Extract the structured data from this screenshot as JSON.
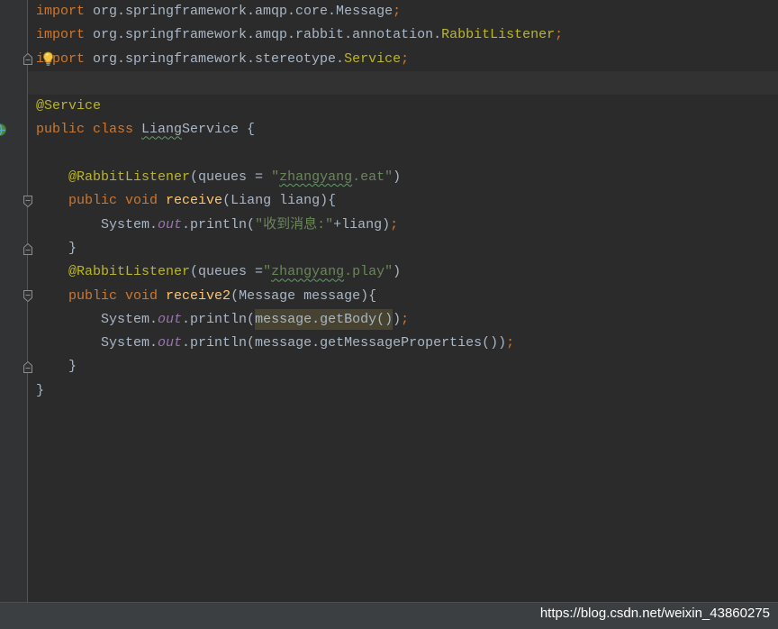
{
  "theme": {
    "background": "#2b2b2b",
    "gutter": "#313335",
    "gutter_border": "#555555",
    "current_line": "#323232",
    "keyword": "#cc7832",
    "text": "#a9b7c6",
    "annotation": "#bbb529",
    "string": "#6a8759",
    "method": "#ffc66d",
    "field": "#9876aa",
    "usage_highlight": "#474330",
    "typo_underline": "#659c6b",
    "fold_marker": "#8c8c8c",
    "bottom_bar": "#3c3f41",
    "watermark": "#ffffff"
  },
  "editor": {
    "lines": [
      {
        "tokens": [
          {
            "keyword": "import"
          },
          {
            "text": " org.springframework.amqp.core.Message"
          },
          {
            "keyword": ";"
          }
        ]
      },
      {
        "tokens": [
          {
            "keyword": "import"
          },
          {
            "text": " org.springframework.amqp.rabbit.annotation."
          },
          {
            "annotation": "RabbitListener"
          },
          {
            "keyword": ";"
          }
        ]
      },
      {
        "gutter_icon": "fold-end-icon",
        "inline_icon": "lightbulb-icon",
        "tokens": [
          {
            "keyword": "import"
          },
          {
            "text": " org.springframework.stereotype."
          },
          {
            "annotation": "Service"
          },
          {
            "keyword": ";"
          }
        ]
      },
      {
        "current": true,
        "tokens": []
      },
      {
        "tokens": [
          {
            "annotation": "@Service"
          }
        ]
      },
      {
        "gutter_icon": "spring-bean-icon",
        "tokens": [
          {
            "keyword": "public class "
          },
          {
            "text": "Liang",
            "typo": true
          },
          {
            "text": "Service {"
          }
        ]
      },
      {
        "tokens": []
      },
      {
        "tokens": [
          {
            "text": "    "
          },
          {
            "annotation": "@RabbitListener"
          },
          {
            "text": "(queues = "
          },
          {
            "string": "\""
          },
          {
            "string": "zhangyang",
            "typo": true
          },
          {
            "string": ".eat\""
          },
          {
            "text": ")"
          }
        ]
      },
      {
        "gutter_icon": "fold-start-icon",
        "tokens": [
          {
            "text": "    "
          },
          {
            "keyword": "public void "
          },
          {
            "method": "receive"
          },
          {
            "text": "(Liang liang){"
          }
        ]
      },
      {
        "tokens": [
          {
            "text": "        System."
          },
          {
            "field": "out"
          },
          {
            "text": ".println("
          },
          {
            "string": "\"收到消息:\""
          },
          {
            "text": "+liang)"
          },
          {
            "keyword": ";"
          }
        ]
      },
      {
        "gutter_icon": "fold-end-icon",
        "tokens": [
          {
            "text": "    }"
          }
        ]
      },
      {
        "tokens": [
          {
            "text": "    "
          },
          {
            "annotation": "@RabbitListener"
          },
          {
            "text": "(queues ="
          },
          {
            "string": "\""
          },
          {
            "string": "zhangyang",
            "typo": true
          },
          {
            "string": ".play\""
          },
          {
            "text": ")"
          }
        ]
      },
      {
        "gutter_icon": "fold-start-icon",
        "tokens": [
          {
            "text": "    "
          },
          {
            "keyword": "public void "
          },
          {
            "method": "receive2"
          },
          {
            "text": "(Message message){"
          }
        ]
      },
      {
        "tokens": [
          {
            "text": "        System."
          },
          {
            "field": "out"
          },
          {
            "text": ".println("
          },
          {
            "text": "message.getBody()",
            "usage_highlight": true
          },
          {
            "text": ")"
          },
          {
            "keyword": ";"
          }
        ]
      },
      {
        "tokens": [
          {
            "text": "        System."
          },
          {
            "field": "out"
          },
          {
            "text": ".println(message.getMessageProperties())"
          },
          {
            "keyword": ";"
          }
        ]
      },
      {
        "gutter_icon": "fold-end-icon",
        "tokens": [
          {
            "text": "    }"
          }
        ]
      },
      {
        "tokens": [
          {
            "text": "}"
          }
        ]
      }
    ]
  },
  "watermark": {
    "text": "https://blog.csdn.net/weixin_43860275"
  }
}
